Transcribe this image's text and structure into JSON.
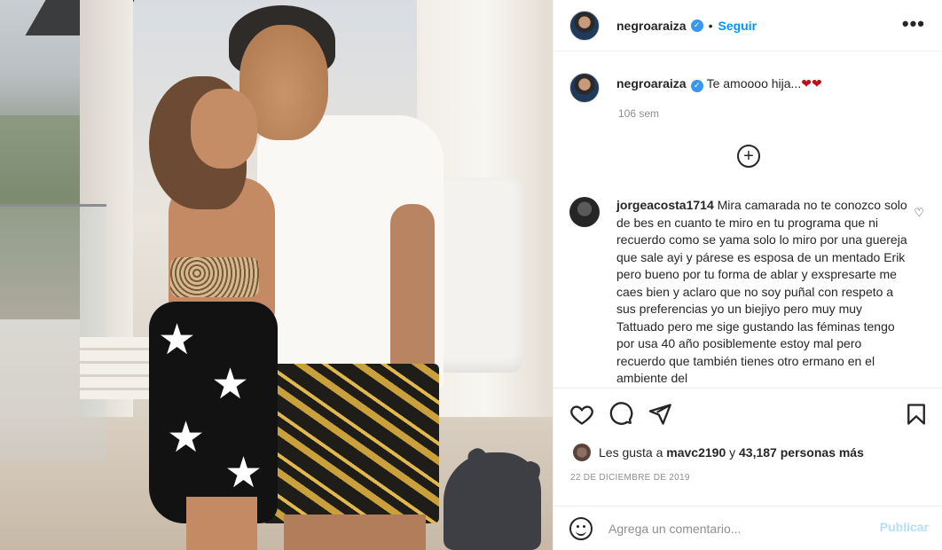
{
  "post": {
    "username": "negroaraiza",
    "verified_mark": "✓",
    "dot": "•",
    "follow_label": "Seguir",
    "more_label": "•••"
  },
  "caption": {
    "username": "negroaraiza",
    "text": "Te amoooo hija...",
    "hearts": "❤❤",
    "time": "106 sem"
  },
  "load_more": {
    "label": "+"
  },
  "comment": {
    "username": "jorgeacosta1714",
    "text": "Mira camarada no te conozco solo de bes en cuanto te miro en tu programa que ni recuerdo como se yama solo lo miro por una guereja que sale ayi y párese es esposa de un mentado Erik pero bueno por tu forma de ablar y exspresarte me caes bien y aclaro que no soy puñal con respeto a sus preferencias yo un biejiyo pero muy muy Tattuado pero me sige gustando las féminas tengo por usa 40 año posiblemente estoy mal pero recuerdo que también tienes otro ermano en el ambiente del",
    "like_icon": "♡"
  },
  "likes": {
    "prefix": "Les gusta a",
    "user": "mavc2190",
    "connector": "y",
    "count_text": "43,187 personas más"
  },
  "date": "22 DE DICIEMBRE DE 2019",
  "add_comment": {
    "placeholder": "Agrega un comentario...",
    "publish_label": "Publicar"
  },
  "icons": {
    "like": "heart-icon",
    "comment": "comment-bubble-icon",
    "share": "send-icon",
    "save": "bookmark-icon",
    "emoji": "smiley-icon"
  },
  "colors": {
    "accent": "#0095f6",
    "verified": "#3897f0",
    "publish_disabled": "#b2dffc",
    "heart": "#c0101b"
  }
}
